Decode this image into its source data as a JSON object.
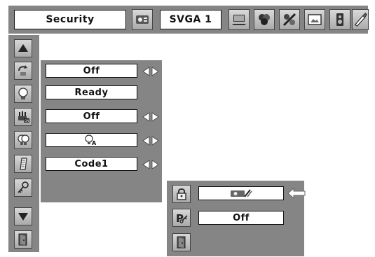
{
  "header": {
    "menu_title": "Security",
    "input_source": "SVGA 1",
    "icons": [
      "projector-icon",
      "computer-icon",
      "color-dots-icon",
      "image-adjust-icon",
      "screen-icon",
      "speaker-icon",
      "setting-icon"
    ]
  },
  "sidebar": {
    "icons": [
      "scroll-up-icon",
      "exit-arrow-icon",
      "lamp-icon",
      "power-on-icon",
      "lamp-mode-icon",
      "filter-icon",
      "key-icon",
      "scroll-down-icon",
      "exit-door-icon"
    ]
  },
  "settings": {
    "row1_value": "Off",
    "row2_value": "Ready",
    "row3_value": "Off",
    "row4_icon": "lamp-a-icon",
    "row5_value": "Code1"
  },
  "submenu": {
    "row1_icon": "projector-logo-icon",
    "row2_value": "Off",
    "icons": [
      "lock-icon",
      "p-key-icon",
      "exit-door-icon"
    ]
  },
  "colors": {
    "panel": "#858585",
    "field_bg": "#ffffff"
  }
}
